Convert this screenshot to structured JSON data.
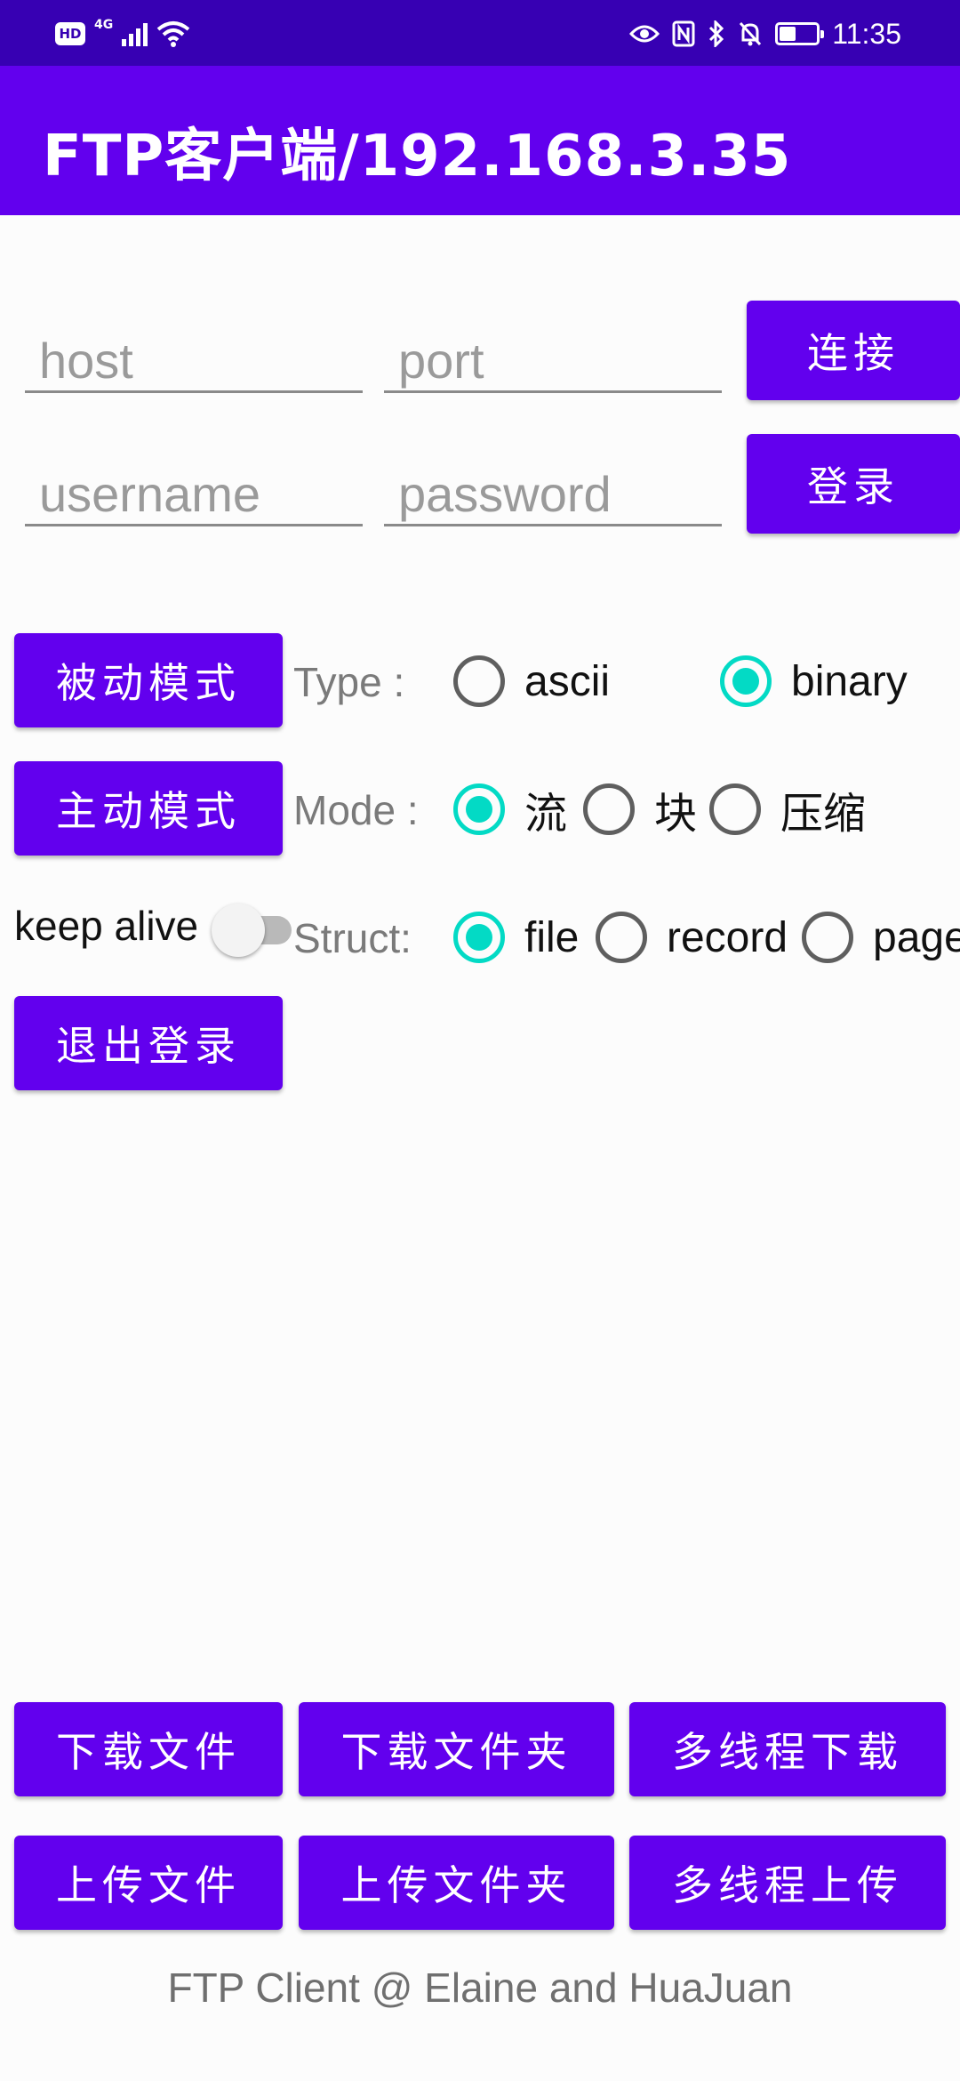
{
  "status_bar": {
    "hd": "HD",
    "network": "4G",
    "time": "11:35",
    "icons": [
      "signal-icon",
      "wifi-icon",
      "eye-icon",
      "nfc-icon",
      "bluetooth-icon",
      "mute-icon",
      "battery-icon"
    ]
  },
  "app_bar": {
    "title": "FTP客户端/192.168.3.35"
  },
  "connection": {
    "host_placeholder": "host",
    "port_placeholder": "port",
    "username_placeholder": "username",
    "password_placeholder": "password",
    "connect_label": "连接",
    "login_label": "登录"
  },
  "modes": {
    "passive_label": "被动模式",
    "active_label": "主动模式",
    "logout_label": "退出登录",
    "keep_alive_label": "keep alive",
    "keep_alive_on": false
  },
  "type": {
    "label": "Type :",
    "options": [
      {
        "label": "ascii",
        "selected": false
      },
      {
        "label": "binary",
        "selected": true
      }
    ]
  },
  "mode": {
    "label": "Mode :",
    "options": [
      {
        "label": "流",
        "selected": true
      },
      {
        "label": "块",
        "selected": false
      },
      {
        "label": "压缩",
        "selected": false
      }
    ]
  },
  "struct": {
    "label": "Struct:",
    "options": [
      {
        "label": "file",
        "selected": true
      },
      {
        "label": "record",
        "selected": false
      },
      {
        "label": "page",
        "selected": false
      }
    ]
  },
  "actions": {
    "download_file": "下载文件",
    "download_folder": "下载文件夹",
    "multi_download": "多线程下载",
    "upload_file": "上传文件",
    "upload_folder": "上传文件夹",
    "multi_upload": "多线程上传"
  },
  "footer": {
    "text": "FTP Client @ Elaine and HuaJuan"
  },
  "colors": {
    "primary": "#6200ee",
    "primary_dark": "#3700b3",
    "accent": "#03dac5"
  }
}
